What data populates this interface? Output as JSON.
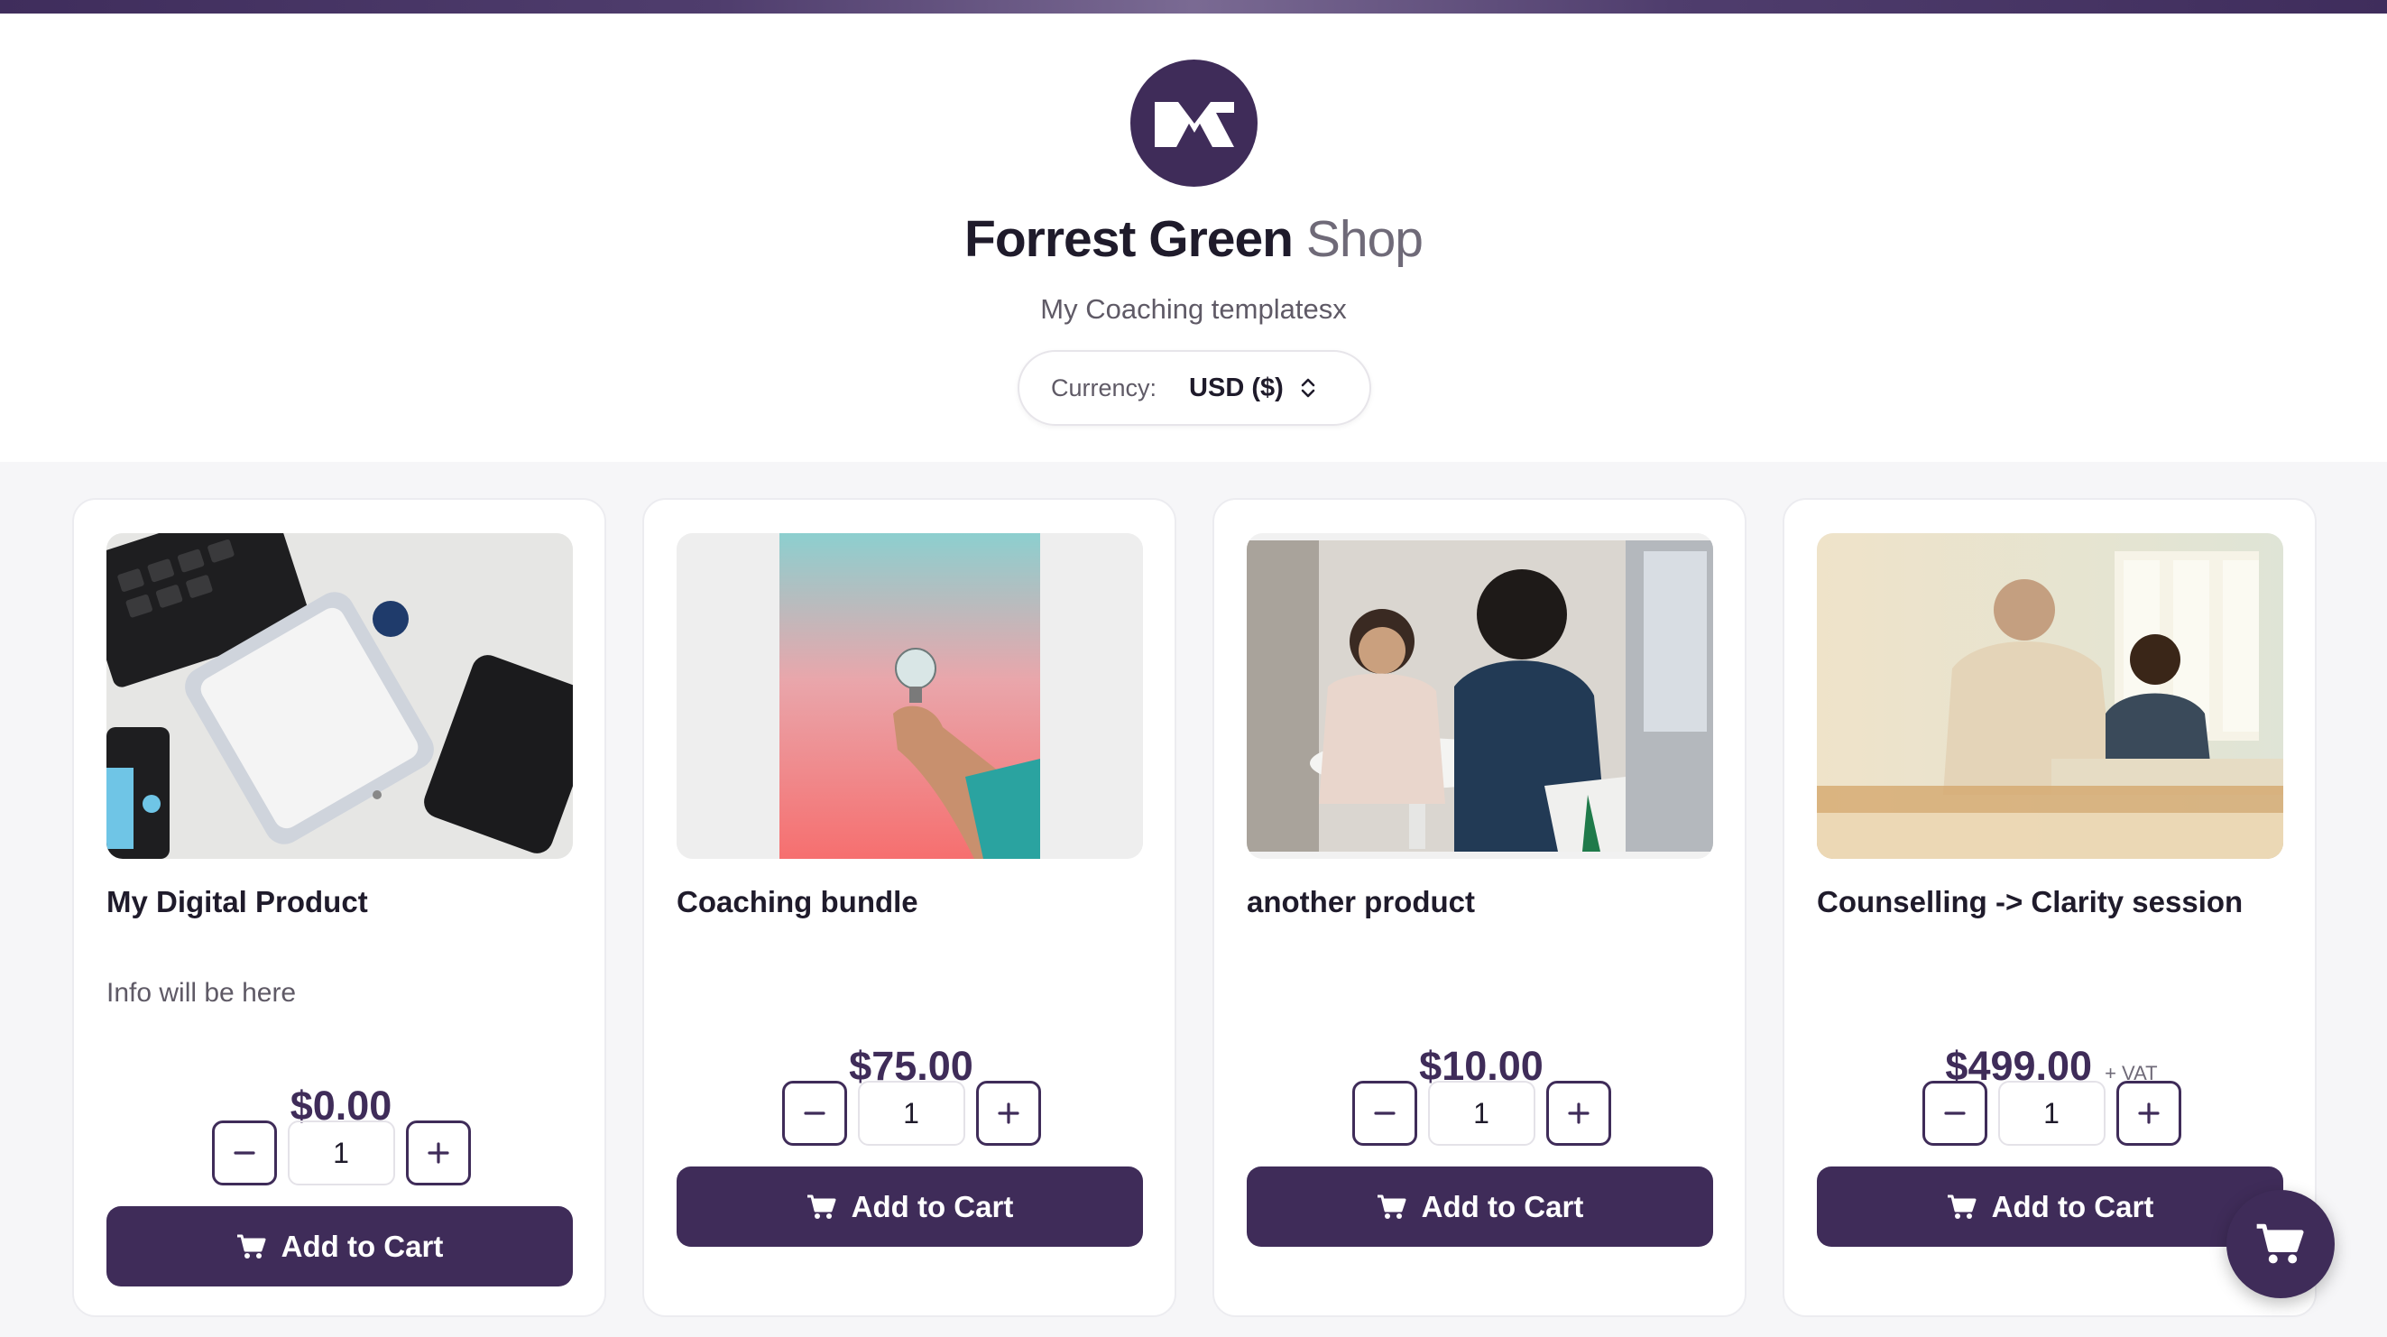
{
  "shop": {
    "name": "Forrest Green",
    "suffix": "Shop",
    "subtitle": "My Coaching templatesx",
    "logo_icon": "monogram-logo-icon"
  },
  "currency": {
    "label": "Currency:",
    "value": "USD ($)"
  },
  "products": [
    {
      "title": "My Digital Product",
      "info": "Info will be here",
      "price": "$0.00",
      "vat": "",
      "qty": "1",
      "button": "Add to Cart",
      "image": "phone-keyboard-speaker-flatlay"
    },
    {
      "title": "Coaching bundle",
      "info": "",
      "price": "$75.00",
      "vat": "",
      "qty": "1",
      "button": "Add to Cart",
      "image": "hand-holding-lightbulb"
    },
    {
      "title": "another product",
      "info": "",
      "price": "$10.00",
      "vat": "",
      "qty": "1",
      "button": "Add to Cart",
      "image": "two-women-meeting"
    },
    {
      "title": "Counselling -> Clarity session",
      "info": "",
      "price": "$499.00",
      "vat": "+ VAT",
      "qty": "1",
      "button": "Add to Cart",
      "image": "two-men-meeting"
    }
  ],
  "colors": {
    "brand": "#3f2c59",
    "background": "#f6f6f8"
  },
  "cart_icon": "shopping-cart-icon"
}
